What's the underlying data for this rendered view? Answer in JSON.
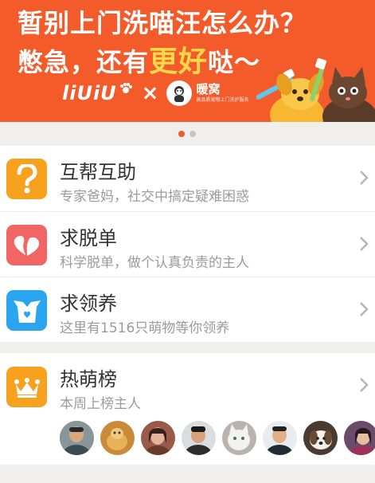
{
  "banner": {
    "line1": "暂别上门洗喵汪怎么办？",
    "line2_prefix": "憋急，还有",
    "line2_highlight": "更好",
    "line2_suffix": "哒～",
    "brand_a": "liUiU",
    "brand_x": "×",
    "brand_b": "暖窝",
    "brand_b_sub": "高品质宠物上门洗护服务"
  },
  "pager": {
    "count": 2,
    "active_index": 0
  },
  "menu": [
    {
      "title": "互帮互助",
      "subtitle": "专家爸妈，社交中搞定疑难困惑",
      "icon": "question-icon",
      "color": "#f6a21e"
    },
    {
      "title": "求脱单",
      "subtitle": "科学脱单，做个认真负责的主人",
      "icon": "heart-icon",
      "color": "#f26565"
    },
    {
      "title": "求领养",
      "subtitle": "这里有1516只萌物等你领养",
      "icon": "box-icon",
      "color": "#2aa5ef"
    }
  ],
  "ranking": {
    "title": "热萌榜",
    "subtitle": "本周上榜主人",
    "icon": "crown-icon",
    "color": "#f6a21e",
    "avatar_count": 8
  },
  "colors": {
    "accent": "#f35b2b",
    "highlight": "#ffd84a"
  }
}
